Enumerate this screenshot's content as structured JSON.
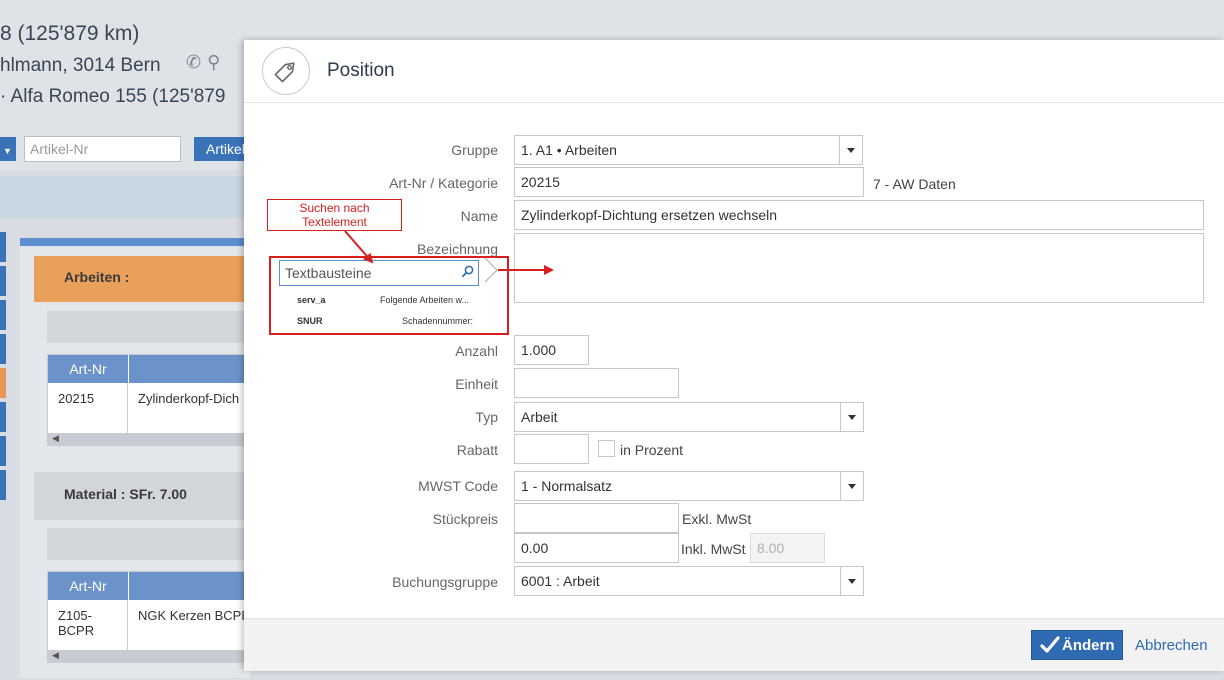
{
  "background": {
    "line1": "8 (125'879 km)",
    "line2": "hlmann, 3014 Bern",
    "line3": "· Alfa Romeo 155 (125'879",
    "articlenr_placeholder": "Artikel-Nr",
    "article_button": "Artikel",
    "section_work": "Arbeiten :",
    "section_material": "Material : SFr. 7.00",
    "table_header_artnr": "Art-Nr",
    "row1_artnr": "20215",
    "row1_desc": "Zylinderkopf-Dich",
    "row2_artnr": "Z105-BCPR",
    "row2_desc": "NGK Kerzen BCPR"
  },
  "dialog": {
    "title": "Position",
    "fields": {
      "gruppe": {
        "label": "Gruppe",
        "value": "1. A1 • Arbeiten"
      },
      "artnr": {
        "label": "Art-Nr / Kategorie",
        "value": "20215",
        "category": "7 - AW Daten"
      },
      "name": {
        "label": "Name",
        "value": "Zylinderkopf-Dichtung ersetzen wechseln"
      },
      "bezeichnung": {
        "label": "Bezeichnung",
        "value": ""
      },
      "anzahl": {
        "label": "Anzahl",
        "value": "1.000"
      },
      "einheit": {
        "label": "Einheit",
        "value": ""
      },
      "typ": {
        "label": "Typ",
        "value": "Arbeit"
      },
      "rabatt": {
        "label": "Rabatt",
        "value": "",
        "percent_label": "in Prozent"
      },
      "mwst": {
        "label": "MWST Code",
        "value": "1 - Normalsatz"
      },
      "stueckpreis": {
        "label": "Stückpreis",
        "exkl_value": "",
        "exkl_label": "Exkl. MwSt",
        "inkl_value": "0.00",
        "inkl_label": "Inkl. MwSt",
        "inkl_readonly": "8.00"
      },
      "buchungsgruppe": {
        "label": "Buchungsgruppe",
        "value": "6001 : Arbeit"
      }
    },
    "buttons": {
      "save": "Ändern",
      "cancel": "Abbrechen"
    }
  },
  "annotation": {
    "note_line1": "Suchen nach",
    "note_line2": "Textelement",
    "search_placeholder": "Textbausteine",
    "items": [
      {
        "key": "serv_a",
        "text": "Folgende Arbeiten w..."
      },
      {
        "key": "SNUR",
        "text": "Schadennummer:"
      }
    ],
    "accent_color": "#d81e1e"
  }
}
